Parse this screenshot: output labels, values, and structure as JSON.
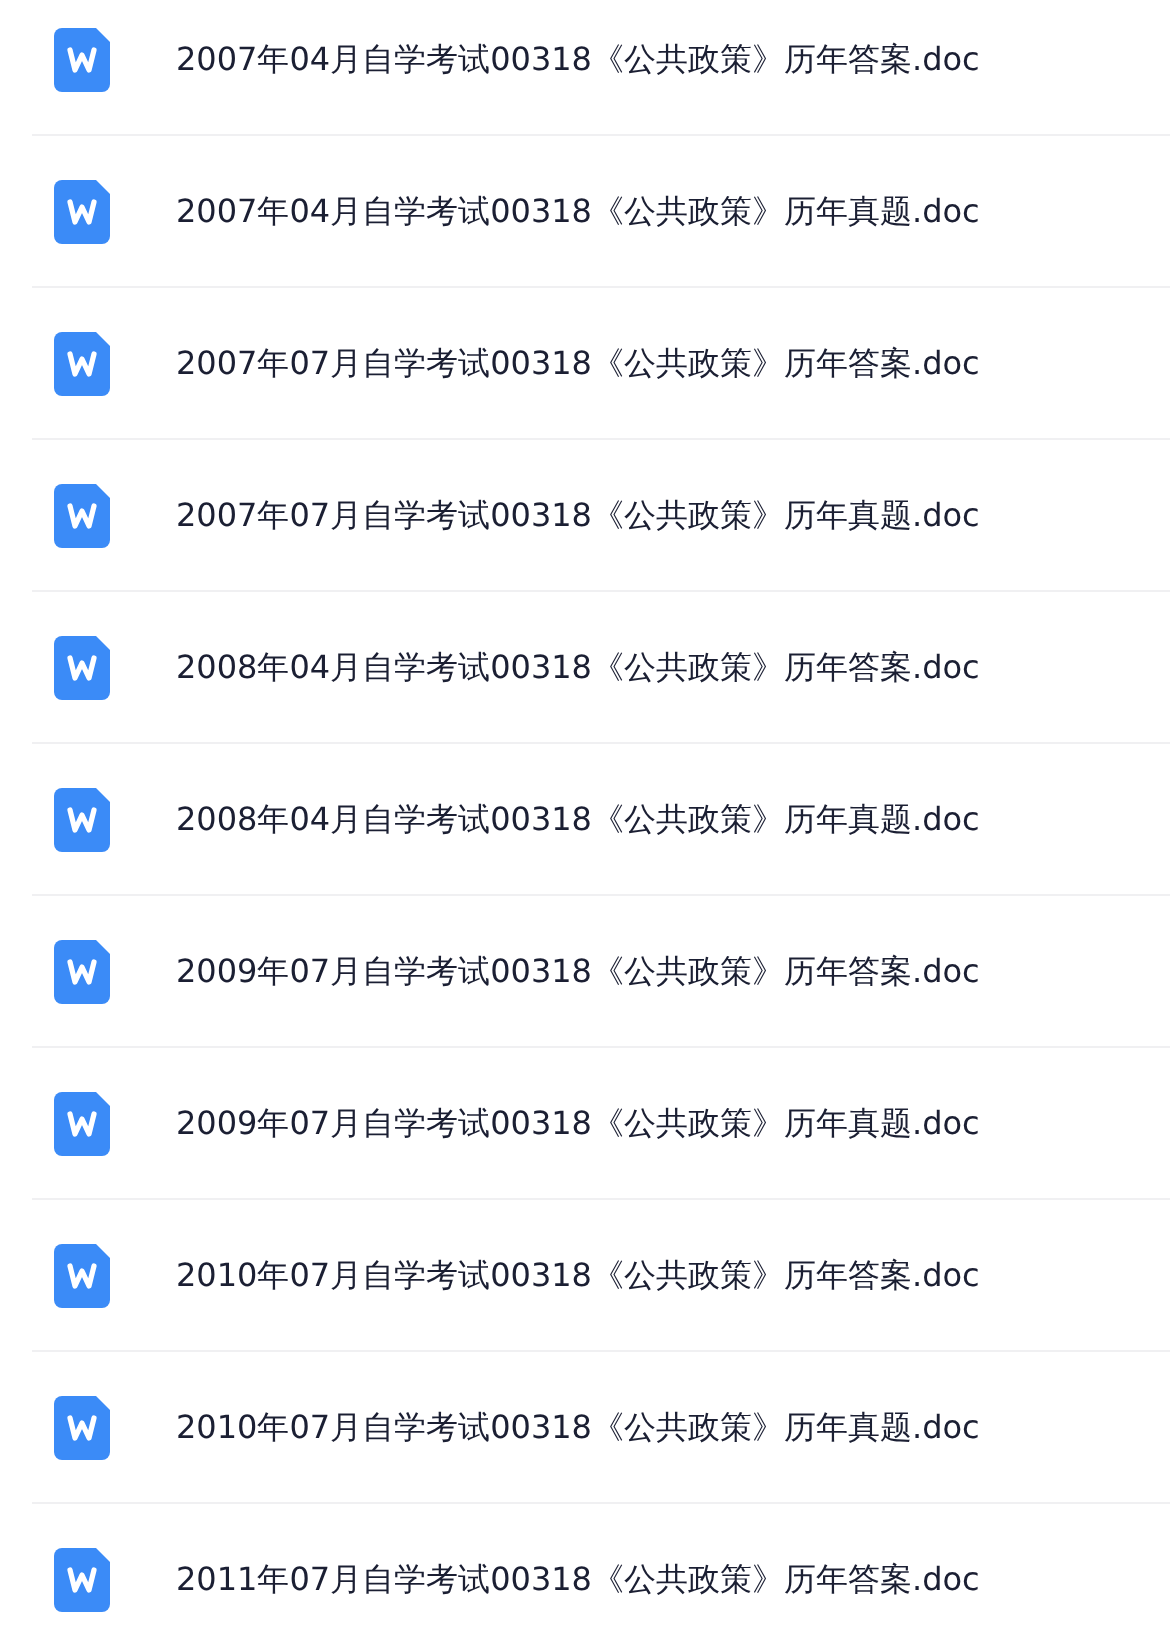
{
  "files": [
    {
      "name": "2007年04月自学考试00318《公共政策》历年答案.doc"
    },
    {
      "name": "2007年04月自学考试00318《公共政策》历年真题.doc"
    },
    {
      "name": "2007年07月自学考试00318《公共政策》历年答案.doc"
    },
    {
      "name": "2007年07月自学考试00318《公共政策》历年真题.doc"
    },
    {
      "name": "2008年04月自学考试00318《公共政策》历年答案.doc"
    },
    {
      "name": "2008年04月自学考试00318《公共政策》历年真题.doc"
    },
    {
      "name": "2009年07月自学考试00318《公共政策》历年答案.doc"
    },
    {
      "name": "2009年07月自学考试00318《公共政策》历年真题.doc"
    },
    {
      "name": "2010年07月自学考试00318《公共政策》历年答案.doc"
    },
    {
      "name": "2010年07月自学考试00318《公共政策》历年真题.doc"
    },
    {
      "name": "2011年07月自学考试00318《公共政策》历年答案.doc"
    }
  ]
}
